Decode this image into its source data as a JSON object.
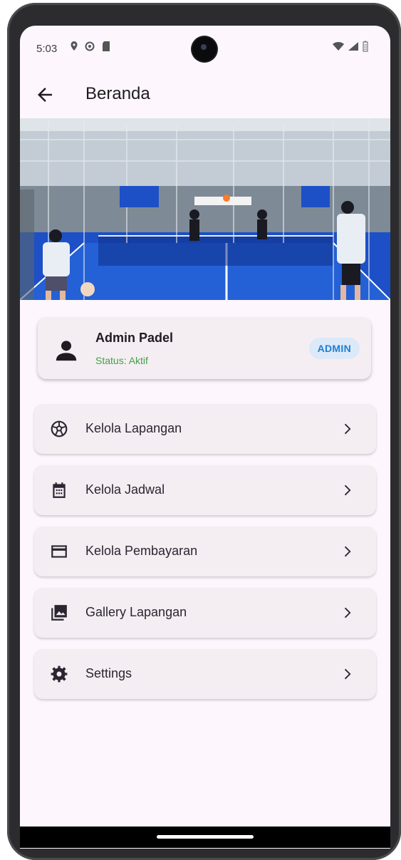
{
  "status_bar": {
    "time": "5:03",
    "left_icons": [
      "location-icon",
      "settings-icon",
      "sd-card-icon"
    ],
    "right_icons": [
      "wifi-icon",
      "signal-icon",
      "battery-icon"
    ]
  },
  "app_bar": {
    "title": "Beranda",
    "back_icon": "arrow-left-icon"
  },
  "profile": {
    "name": "Admin Padel",
    "status": "Status: Aktif",
    "role": "ADMIN",
    "status_color": "#43a047",
    "badge_color": "#1f7ed2"
  },
  "menu": [
    {
      "label": "Kelola Lapangan",
      "icon": "soccer-ball-icon"
    },
    {
      "label": "Kelola Jadwal",
      "icon": "calendar-icon"
    },
    {
      "label": "Kelola Pembayaran",
      "icon": "credit-card-icon"
    },
    {
      "label": "Gallery Lapangan",
      "icon": "photo-library-icon"
    },
    {
      "label": "Settings",
      "icon": "gear-icon"
    }
  ],
  "colors": {
    "background": "#fdf7fd",
    "card": "#f4eef3",
    "court_blue": "#1c4ec4"
  }
}
